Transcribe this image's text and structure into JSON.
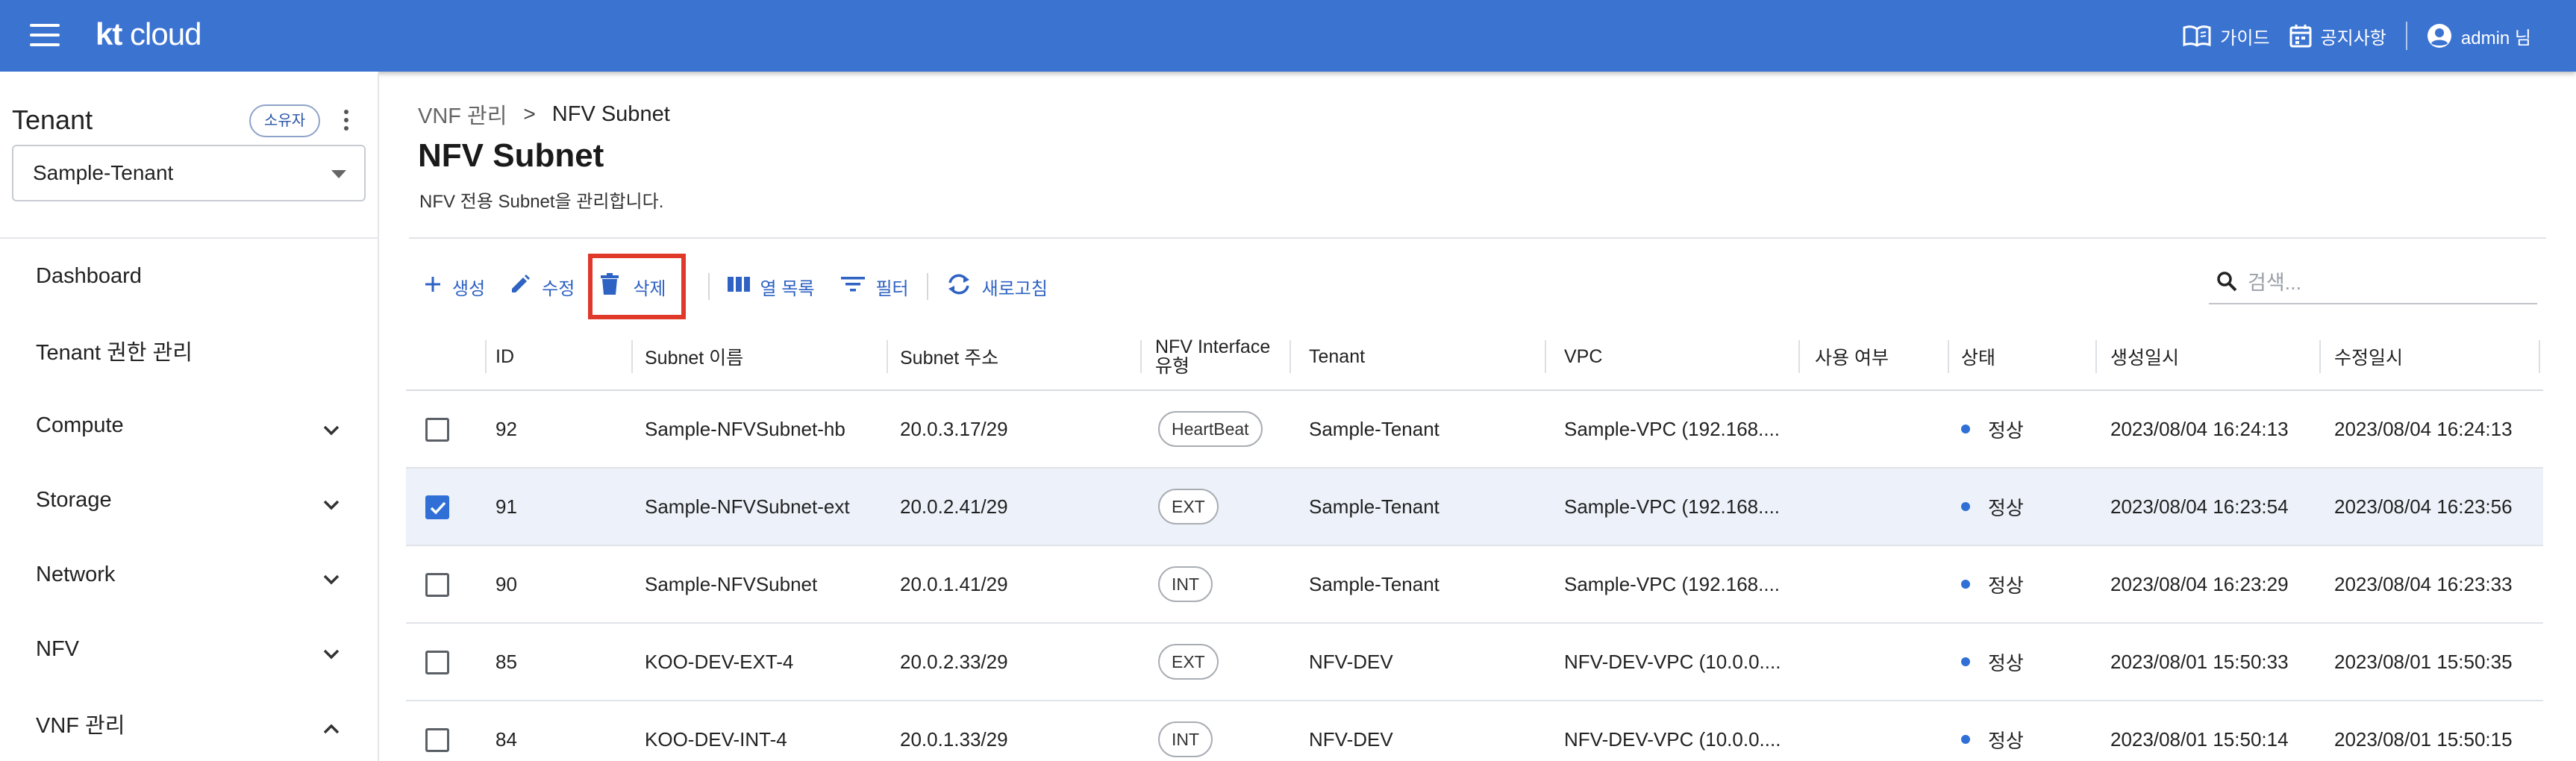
{
  "app": {
    "logo_brand": "kt",
    "logo_product": " cloud"
  },
  "topbar": {
    "guide_label": "가이드",
    "notice_label": "공지사항",
    "user_label": "admin 님"
  },
  "sidebar": {
    "tenant_title": "Tenant",
    "owner_badge": "소유자",
    "tenant_selected": "Sample-Tenant",
    "items": [
      {
        "label": "Dashboard",
        "expandable": false
      },
      {
        "label": "Tenant 권한 관리",
        "expandable": false
      },
      {
        "label": "Compute",
        "expandable": true,
        "expanded": false
      },
      {
        "label": "Storage",
        "expandable": true,
        "expanded": false
      },
      {
        "label": "Network",
        "expandable": true,
        "expanded": false
      },
      {
        "label": "NFV",
        "expandable": true,
        "expanded": false
      },
      {
        "label": "VNF 관리",
        "expandable": true,
        "expanded": true
      }
    ]
  },
  "breadcrumb": {
    "parent": "VNF 관리",
    "separator": ">",
    "current": "NFV Subnet"
  },
  "page": {
    "title": "NFV Subnet",
    "description": "NFV 전용 Subnet을 관리합니다."
  },
  "toolbar": {
    "create": "생성",
    "edit": "수정",
    "delete": "삭제",
    "columns": "열 목록",
    "filter": "필터",
    "refresh": "새로고침"
  },
  "search": {
    "placeholder": "검색..."
  },
  "table": {
    "headers": {
      "id": "ID",
      "subnet_name": "Subnet 이름",
      "subnet_address": "Subnet 주소",
      "nfv_type_line1": "NFV Interface",
      "nfv_type_line2": "유형",
      "tenant": "Tenant",
      "vpc": "VPC",
      "in_use": "사용 여부",
      "status": "상태",
      "created": "생성일시",
      "modified": "수정일시"
    },
    "rows": [
      {
        "checked": false,
        "id": "92",
        "name": "Sample-NFVSubnet-hb",
        "address": "20.0.3.17/29",
        "type": "HeartBeat",
        "tenant": "Sample-Tenant",
        "vpc": "Sample-VPC (192.168....",
        "status": "정상",
        "created": "2023/08/04 16:24:13",
        "modified": "2023/08/04 16:24:13"
      },
      {
        "checked": true,
        "id": "91",
        "name": "Sample-NFVSubnet-ext",
        "address": "20.0.2.41/29",
        "type": "EXT",
        "tenant": "Sample-Tenant",
        "vpc": "Sample-VPC (192.168....",
        "status": "정상",
        "created": "2023/08/04 16:23:54",
        "modified": "2023/08/04 16:23:56"
      },
      {
        "checked": false,
        "id": "90",
        "name": "Sample-NFVSubnet",
        "address": "20.0.1.41/29",
        "type": "INT",
        "tenant": "Sample-Tenant",
        "vpc": "Sample-VPC (192.168....",
        "status": "정상",
        "created": "2023/08/04 16:23:29",
        "modified": "2023/08/04 16:23:33"
      },
      {
        "checked": false,
        "id": "85",
        "name": "KOO-DEV-EXT-4",
        "address": "20.0.2.33/29",
        "type": "EXT",
        "tenant": "NFV-DEV",
        "vpc": "NFV-DEV-VPC (10.0.0....",
        "status": "정상",
        "created": "2023/08/01 15:50:33",
        "modified": "2023/08/01 15:50:35"
      },
      {
        "checked": false,
        "id": "84",
        "name": "KOO-DEV-INT-4",
        "address": "20.0.1.33/29",
        "type": "INT",
        "tenant": "NFV-DEV",
        "vpc": "NFV-DEV-VPC (10.0.0....",
        "status": "정상",
        "created": "2023/08/01 15:50:14",
        "modified": "2023/08/01 15:50:15"
      }
    ]
  },
  "colors": {
    "topbar": "#3b73d1",
    "accent": "#2e62c3",
    "highlight_box": "#e0392a",
    "selected_row": "#edf2fa"
  }
}
